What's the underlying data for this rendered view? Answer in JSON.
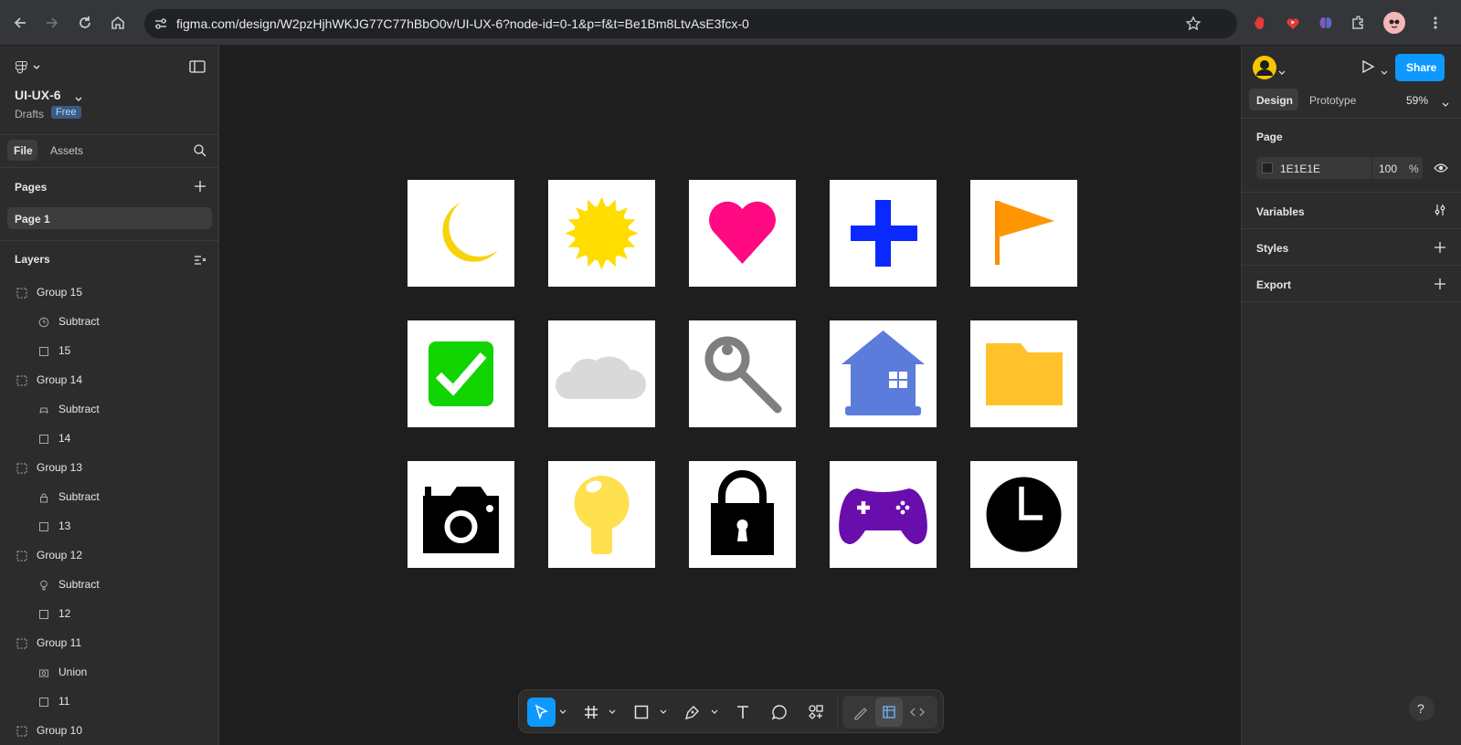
{
  "browser": {
    "url": "figma.com/design/W2pzHjhWKJG77C77hBbO0v/UI-UX-6?node-id=0-1&p=f&t=Be1Bm8LtvAsE3fcx-0"
  },
  "left_panel": {
    "file_name": "UI-UX-6",
    "location": "Drafts",
    "plan_badge": "Free",
    "tabs": [
      "File",
      "Assets"
    ],
    "pages_header": "Pages",
    "pages": [
      "Page 1"
    ],
    "layers_header": "Layers",
    "layers": [
      {
        "label": "Group 15",
        "icon": "group-icon"
      },
      {
        "label": "Subtract",
        "icon": "clock-icon"
      },
      {
        "label": "15",
        "icon": "frame-icon"
      },
      {
        "label": "Group 14",
        "icon": "group-icon"
      },
      {
        "label": "Subtract",
        "icon": "gamepad-icon"
      },
      {
        "label": "14",
        "icon": "frame-icon"
      },
      {
        "label": "Group 13",
        "icon": "group-icon"
      },
      {
        "label": "Subtract",
        "icon": "lock-icon"
      },
      {
        "label": "13",
        "icon": "frame-icon"
      },
      {
        "label": "Group 12",
        "icon": "group-icon"
      },
      {
        "label": "Subtract",
        "icon": "bulb-icon"
      },
      {
        "label": "12",
        "icon": "frame-icon"
      },
      {
        "label": "Group 11",
        "icon": "group-icon"
      },
      {
        "label": "Union",
        "icon": "camera-icon"
      },
      {
        "label": "11",
        "icon": "frame-icon"
      },
      {
        "label": "Group 10",
        "icon": "group-icon"
      }
    ]
  },
  "canvas": {
    "background": "#1E1E1E",
    "icons": [
      [
        "moon",
        "sun",
        "heart",
        "plus",
        "flag"
      ],
      [
        "checkbox",
        "cloud",
        "magnifier",
        "house",
        "folder"
      ],
      [
        "camera",
        "lightbulb",
        "padlock",
        "gamepad",
        "clock"
      ]
    ]
  },
  "right_panel": {
    "share_label": "Share",
    "tabs": [
      "Design",
      "Prototype"
    ],
    "zoom": "59%",
    "page_header": "Page",
    "page_color": "1E1E1E",
    "page_opacity": "100",
    "percent_sign": "%",
    "sections": [
      "Variables",
      "Styles",
      "Export"
    ]
  },
  "colors": {
    "accent": "#0d99ff",
    "badge_bg": "#3b5a86",
    "badge_text": "#bcd6ff"
  }
}
